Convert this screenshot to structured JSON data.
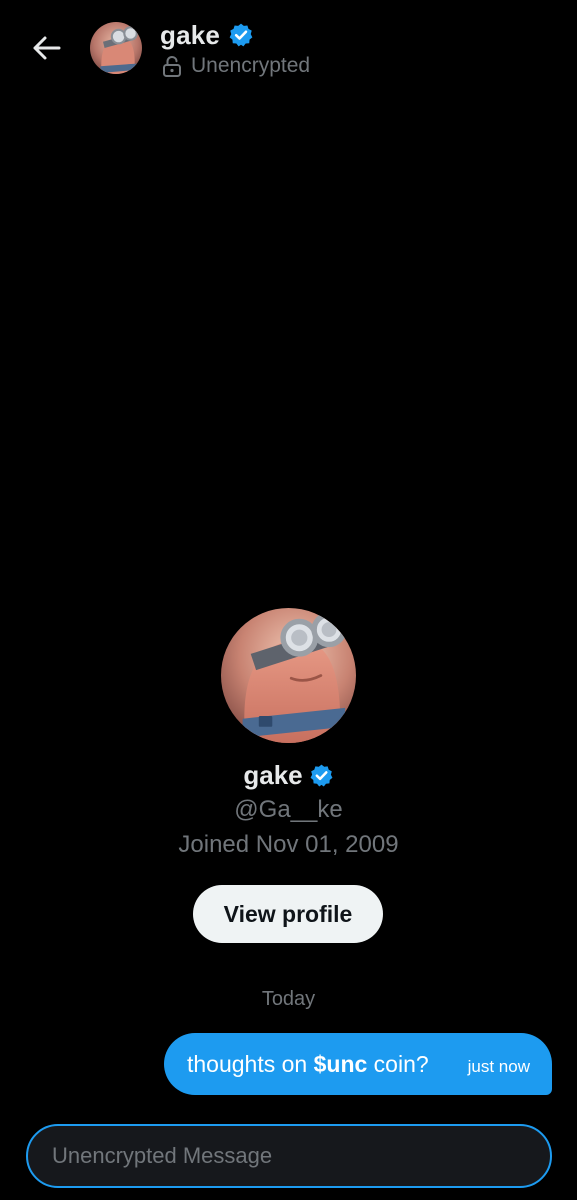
{
  "colors": {
    "background": "#000000",
    "accent": "#1d9bf0",
    "text_primary": "#e7e9ea",
    "text_secondary": "#71767b",
    "button_bg": "#eff3f4",
    "button_text": "#0f1419"
  },
  "header": {
    "back_icon": "arrow-left-icon",
    "name": "gake",
    "verified_icon": "verified-badge-icon",
    "status_icon": "unlocked-padlock-icon",
    "status": "Unencrypted"
  },
  "profile": {
    "name": "gake",
    "verified_icon": "verified-badge-icon",
    "handle": "@Ga__ke",
    "joined": "Joined Nov 01, 2009",
    "view_profile_label": "View profile"
  },
  "conversation": {
    "day_label": "Today",
    "messages": [
      {
        "text_before": "thoughts on ",
        "text_bold": "$unc",
        "text_after": " coin?",
        "time": "just now",
        "outgoing": true
      }
    ]
  },
  "composer": {
    "placeholder": "Unencrypted Message",
    "value": ""
  }
}
